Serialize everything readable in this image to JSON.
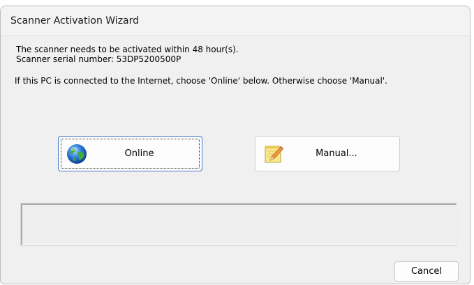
{
  "window": {
    "title": "Scanner Activation Wizard"
  },
  "message": {
    "line1": "The scanner needs to be activated within 48 hour(s).",
    "line2": "Scanner serial number: 53DP5200500P",
    "line3": "If this PC is connected to the Internet, choose 'Online' below. Otherwise choose 'Manual'."
  },
  "buttons": {
    "online_label": "Online",
    "online_icon": "globe-icon",
    "manual_label": "Manual...",
    "manual_icon": "notepad-pencil-icon",
    "cancel_label": "Cancel"
  },
  "status": {
    "text": ""
  },
  "colors": {
    "window_bg": "#f0f0f0",
    "default_button_border": "#4a79c9"
  }
}
